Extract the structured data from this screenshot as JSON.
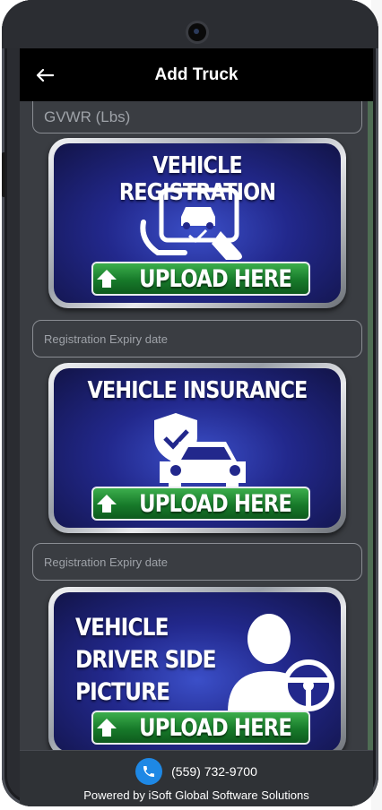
{
  "app_bar": {
    "title": "Add Truck",
    "back_icon": "arrow-left-icon"
  },
  "fields": {
    "gvwr_placeholder": "GVWR (Lbs)",
    "registration_expiry_placeholder": "Registration Expiry date",
    "insurance_expiry_placeholder": "Registration Expiry date"
  },
  "cards": {
    "registration": {
      "title": "VEHICLE REGISTRATION",
      "button": "UPLOAD HERE",
      "icon": "tablet-car-hand-icon"
    },
    "insurance": {
      "title": "VEHICLE INSURANCE",
      "button": "UPLOAD HERE",
      "icon": "shield-car-icon"
    },
    "driver_side": {
      "title_lines": [
        "VEHICLE",
        "DRIVER SIDE",
        "PICTURE"
      ],
      "button": "UPLOAD HERE",
      "icon": "driver-wheel-icon"
    }
  },
  "footer": {
    "phone": "(559) 732-9700",
    "powered_by": "Powered by iSoft Global Software Solutions",
    "phone_icon": "phone-icon"
  },
  "colors": {
    "app_bar": "#000000",
    "upload_green": "#177a2a",
    "card_blue": "#22288c",
    "phone_badge": "#1e88e5"
  }
}
